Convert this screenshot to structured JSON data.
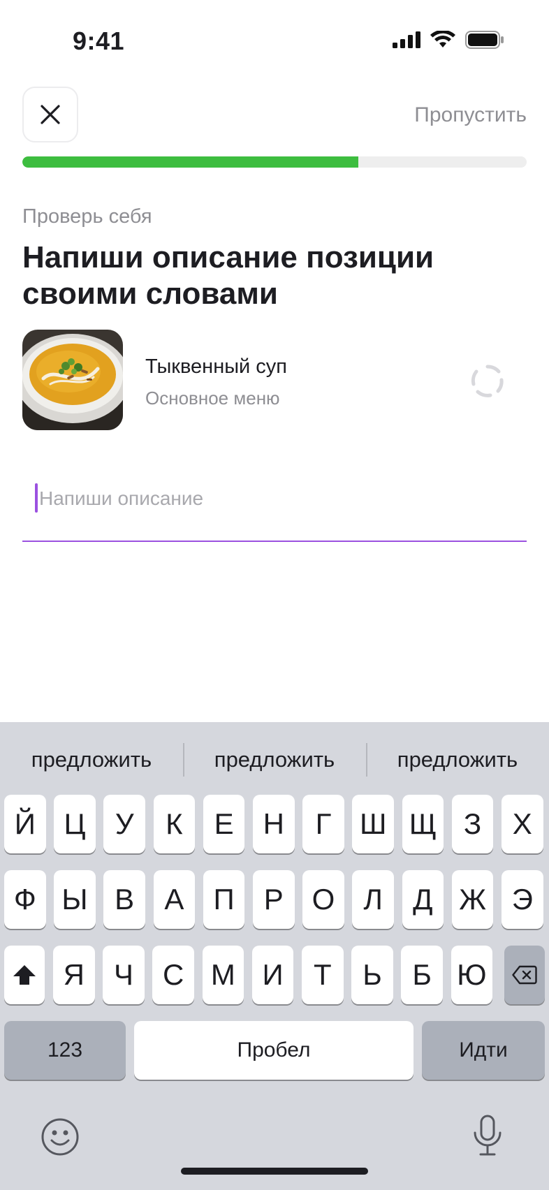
{
  "status_bar": {
    "time": "9:41"
  },
  "header": {
    "skip_label": "Пропустить"
  },
  "progress": {
    "fraction": 0.666,
    "color": "#3dbd3f"
  },
  "content": {
    "subtitle": "Проверь себя",
    "title": "Напиши описание позиции своими словами"
  },
  "item": {
    "name": "Тыквенный суп",
    "category": "Основное меню"
  },
  "description_field": {
    "placeholder": "Напиши описание",
    "value": "",
    "accent": "#9b51e0"
  },
  "keyboard": {
    "suggestions": [
      "предложить",
      "предложить",
      "предложить"
    ],
    "rows": [
      [
        "Й",
        "Ц",
        "У",
        "К",
        "Е",
        "Н",
        "Г",
        "Ш",
        "Щ",
        "З",
        "Х"
      ],
      [
        "Ф",
        "Ы",
        "В",
        "А",
        "П",
        "Р",
        "О",
        "Л",
        "Д",
        "Ж",
        "Э"
      ],
      [
        "Я",
        "Ч",
        "С",
        "М",
        "И",
        "Т",
        "Ь",
        "Б",
        "Ю"
      ]
    ],
    "numbers_label": "123",
    "space_label": "Пробел",
    "go_label": "Идти"
  }
}
